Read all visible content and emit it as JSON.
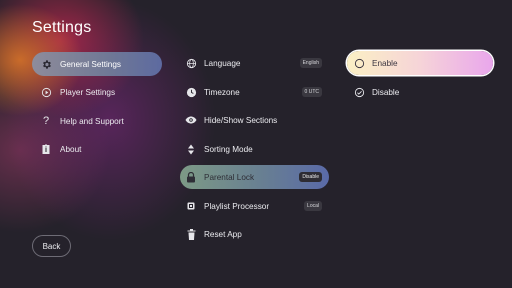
{
  "page_title": "Settings",
  "nav": {
    "items": [
      {
        "label": "General Settings",
        "icon": "gear-icon"
      },
      {
        "label": "Player Settings",
        "icon": "play-circle-icon"
      },
      {
        "label": "Help and Support",
        "icon": "question-icon"
      },
      {
        "label": "About",
        "icon": "info-badge-icon"
      }
    ],
    "selected": "General Settings"
  },
  "options": {
    "items": [
      {
        "label": "Language",
        "value": "English",
        "icon": "globe-icon"
      },
      {
        "label": "Timezone",
        "value": "0 UTC",
        "icon": "clock-icon"
      },
      {
        "label": "Hide/Show Sections",
        "value": "",
        "icon": "eye-icon"
      },
      {
        "label": "Sorting Mode",
        "value": "",
        "icon": "sort-icon"
      },
      {
        "label": "Parental Lock",
        "value": "Disable",
        "icon": "lock-icon"
      },
      {
        "label": "Playlist Processor",
        "value": "Local",
        "icon": "chip-icon"
      },
      {
        "label": "Reset App",
        "value": "",
        "icon": "trash-icon"
      }
    ],
    "selected": "Parental Lock"
  },
  "choices": {
    "items": [
      {
        "label": "Enable",
        "icon": "radio-empty-icon"
      },
      {
        "label": "Disable",
        "icon": "check-circle-icon"
      }
    ],
    "focused": "Enable",
    "checked": "Disable"
  },
  "back_label": "Back",
  "colors": {
    "background": "#25222b",
    "nav_active": "#6f7896",
    "option_active": "#687f92",
    "choice_active": "#f6d4d8"
  }
}
